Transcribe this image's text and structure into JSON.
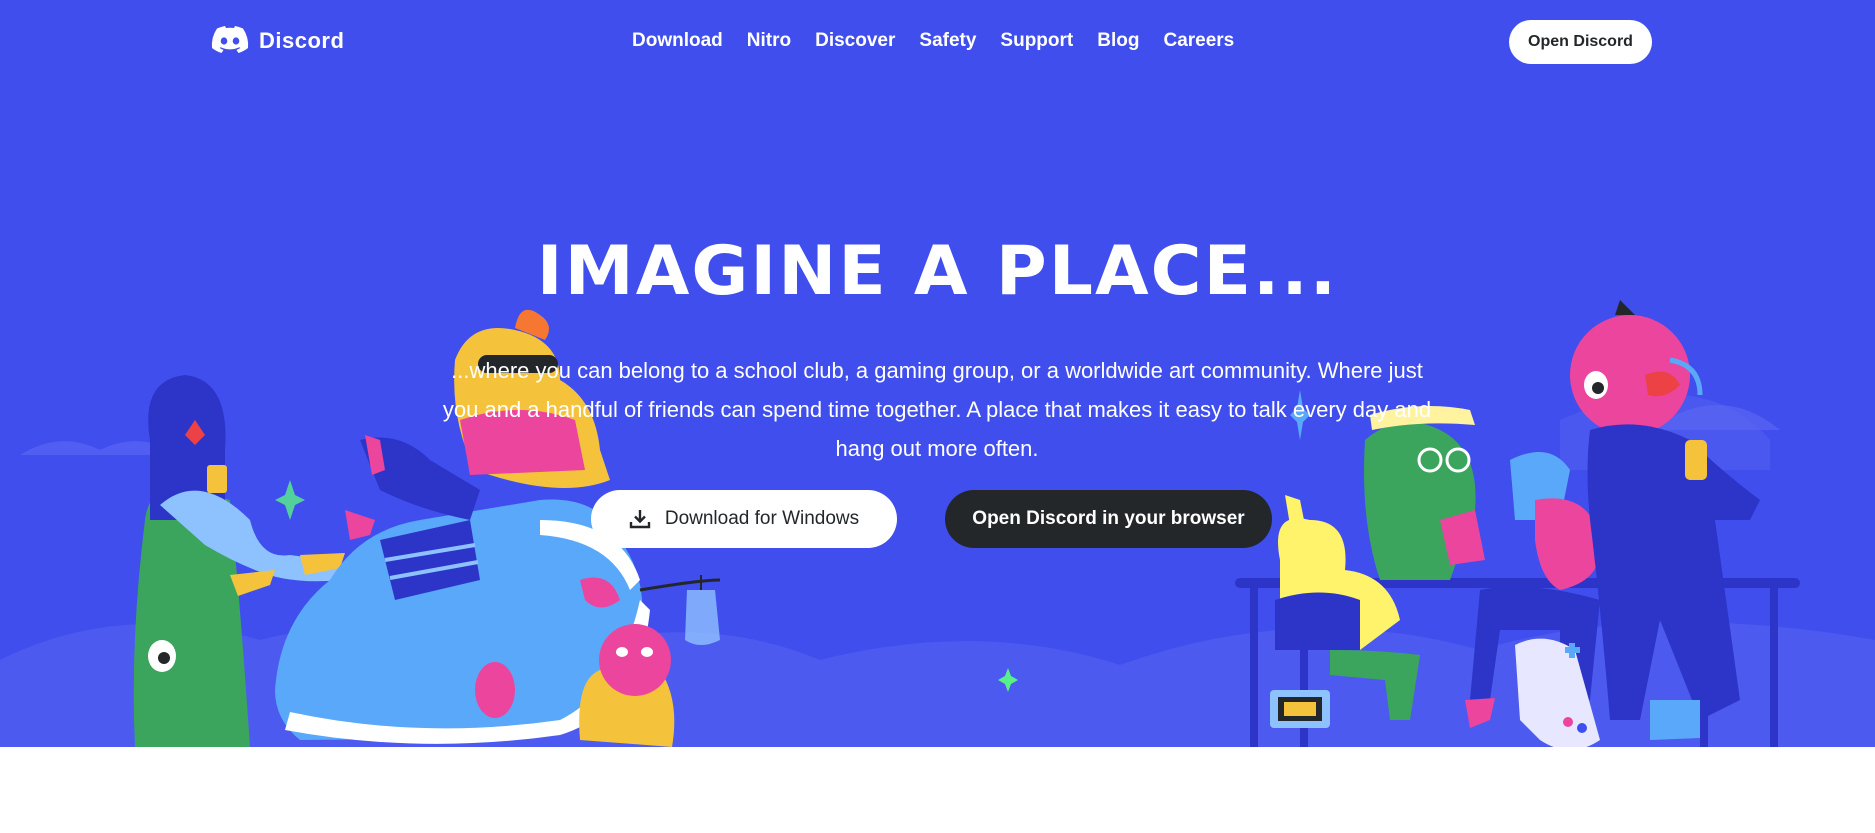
{
  "colors": {
    "blurple": "#404eed",
    "dark": "#23272a",
    "white": "#ffffff"
  },
  "nav": {
    "logo_text": "Discord",
    "links": [
      "Download",
      "Nitro",
      "Discover",
      "Safety",
      "Support",
      "Blog",
      "Careers"
    ],
    "open_button": "Open Discord"
  },
  "hero": {
    "title": "IMAGINE A PLACE...",
    "subtitle": "...where you can belong to a school club, a gaming group, or a worldwide art community. Where just you and a handful of friends can spend time together. A place that makes it easy to talk every day and hang out more often.",
    "download_button": "Download for Windows",
    "download_icon": "download-icon",
    "browser_button": "Open Discord in your browser"
  }
}
